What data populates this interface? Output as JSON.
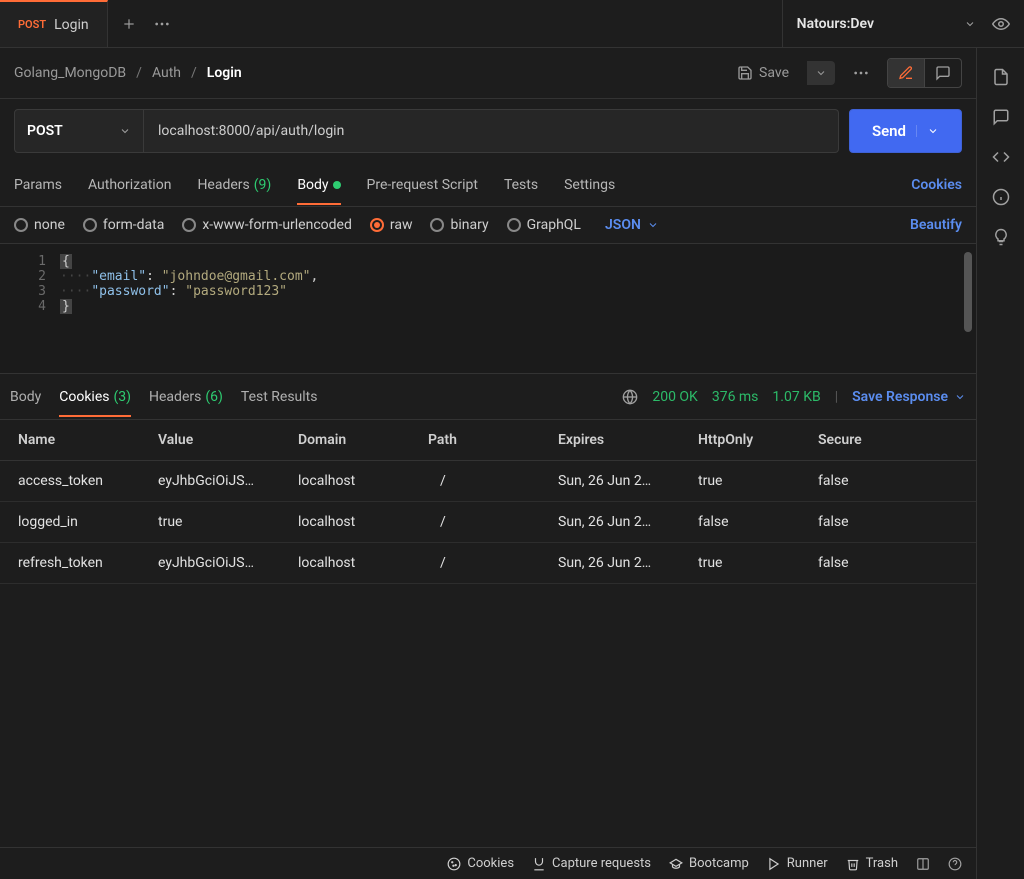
{
  "tab": {
    "method": "POST",
    "title": "Login"
  },
  "env": {
    "name": "Natours:Dev"
  },
  "breadcrumb": {
    "a": "Golang_MongoDB",
    "b": "Auth",
    "c": "Login"
  },
  "save_label": "Save",
  "request": {
    "method": "POST",
    "url": "localhost:8000/api/auth/login",
    "send": "Send"
  },
  "req_tabs": {
    "params": "Params",
    "auth": "Authorization",
    "headers": "Headers",
    "headers_count": "(9)",
    "body": "Body",
    "prerequest": "Pre-request Script",
    "tests": "Tests",
    "settings": "Settings",
    "cookies": "Cookies"
  },
  "body_types": {
    "none": "none",
    "form": "form-data",
    "url": "x-www-form-urlencoded",
    "raw": "raw",
    "binary": "binary",
    "graphql": "GraphQL",
    "json": "JSON",
    "beautify": "Beautify"
  },
  "editor": {
    "l1": "{",
    "k1": "\"email\"",
    "v1": "\"johndoe@gmail.com\"",
    "k2": "\"password\"",
    "v2": "\"password123\"",
    "l4": "}"
  },
  "res_tabs": {
    "body": "Body",
    "cookies": "Cookies",
    "cookies_count": "(3)",
    "headers": "Headers",
    "headers_count": "(6)",
    "tests": "Test Results"
  },
  "status": {
    "code": "200 OK",
    "time": "376 ms",
    "size": "1.07 KB",
    "save": "Save Response"
  },
  "table": {
    "head": {
      "name": "Name",
      "value": "Value",
      "domain": "Domain",
      "path": "Path",
      "expires": "Expires",
      "httponly": "HttpOnly",
      "secure": "Secure"
    },
    "rows": [
      {
        "name": "access_token",
        "value": "eyJhbGciOiJS…",
        "domain": "localhost",
        "path": "/",
        "expires": "Sun, 26 Jun 2…",
        "httponly": "true",
        "secure": "false"
      },
      {
        "name": "logged_in",
        "value": "true",
        "domain": "localhost",
        "path": "/",
        "expires": "Sun, 26 Jun 2…",
        "httponly": "false",
        "secure": "false"
      },
      {
        "name": "refresh_token",
        "value": "eyJhbGciOiJS…",
        "domain": "localhost",
        "path": "/",
        "expires": "Sun, 26 Jun 2…",
        "httponly": "true",
        "secure": "false"
      }
    ]
  },
  "bottom": {
    "cookies": "Cookies",
    "capture": "Capture requests",
    "bootcamp": "Bootcamp",
    "runner": "Runner",
    "trash": "Trash"
  }
}
